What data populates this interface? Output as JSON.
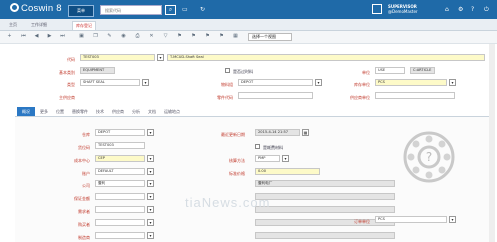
{
  "header": {
    "logo": "Coswin 8",
    "menu_label": "菜单",
    "search_placeholder": "搜索代码",
    "user_name": "SUPERVISOR",
    "user_org": "@DemoMaster"
  },
  "window_tabs": [
    "主页",
    "工作详细",
    "库存登记"
  ],
  "toolbar": {
    "select_label": "选择一个视图"
  },
  "record": {
    "code_label": "代码",
    "code_value": "TEST003",
    "code_desc": "T-MCUD-Shaft Seal",
    "main_category_label": "基本类别",
    "main_category_value": "EQUIPMENT",
    "obsolete_label": "是否过时料",
    "type_label": "类型",
    "type_value": "SHAFT SEAL",
    "stock_type_label": "物料组",
    "stock_type_value": "DEPOT",
    "other_label": "单位",
    "unit_value": "USE",
    "class_label": "类型",
    "class_value": "C:ARTICLE",
    "main_supplier_label": "主供应商",
    "part_code_label": "零件代码",
    "supplier2_label": "供应商单位",
    "stock_unit_label": "库存单位",
    "stock_unit_value": "PCS"
  },
  "section_tabs": [
    "概况",
    "更多",
    "位置",
    "替换零件",
    "技术",
    "供应商",
    "分析",
    "文档",
    "运输地点"
  ],
  "detail": {
    "depot_label": "仓库",
    "depot_value": "DEPOT",
    "subcode_label": "货位码",
    "subcode_value": "TEST003",
    "cost_center_label": "成本中心",
    "cost_center_value": "CEP",
    "account_label": "账户",
    "account_value": "DEFAULT",
    "company_label": "公司",
    "company_value": "壹利",
    "company_desc": "壹利电厂",
    "purchase_label": "采购",
    "storekeeper_label": "保证金额",
    "requester_label": "需求者",
    "buyer_label": "购买者",
    "last_update_label": "最近更新日期",
    "last_update_value": "2015-4-14 21:57",
    "consumable_label": "是耗费材料",
    "valuation_label": "核算方法",
    "valuation_value": "PMP",
    "std_price_label": "标准价格",
    "std_price_value": "0.00",
    "order_unit_label": "订单单位",
    "order_unit_value": "PCS",
    "mfr_label": "制造商"
  },
  "watermark": "tiaNews.com"
}
